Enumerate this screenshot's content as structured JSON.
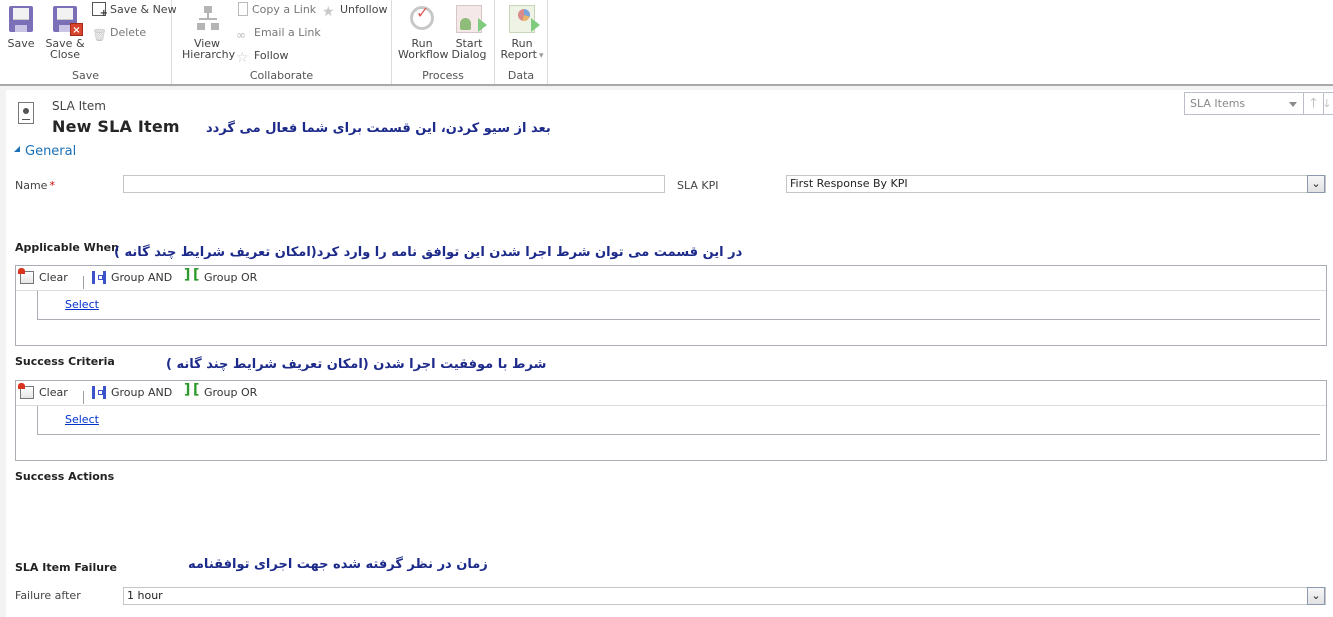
{
  "ribbon": {
    "groups": {
      "save": {
        "label": "Save",
        "save": "Save",
        "save_close_line1": "Save &",
        "save_close_line2": "Close",
        "save_new": "Save & New",
        "delete": "Delete"
      },
      "collaborate": {
        "label": "Collaborate",
        "view_hierarchy_line1": "View",
        "view_hierarchy_line2": "Hierarchy",
        "copy_link": "Copy a Link",
        "email_link": "Email a Link",
        "follow": "Follow",
        "unfollow": "Unfollow"
      },
      "process": {
        "label": "Process",
        "run_workflow_line1": "Run",
        "run_workflow_line2": "Workflow",
        "start_dialog_line1": "Start",
        "start_dialog_line2": "Dialog"
      },
      "data": {
        "label": "Data",
        "run_report_line1": "Run",
        "run_report_line2": "Report",
        "run_report_caret": "▾"
      }
    }
  },
  "header": {
    "entity_type": "SLA Item",
    "title": "New SLA Item",
    "annotation": "بعد از سیو کردن، این قسمت برای شما فعال می گردد",
    "nav": {
      "selected": "SLA Items",
      "up_icon": "🡑",
      "down_icon": "🡓"
    }
  },
  "section": {
    "label": "General"
  },
  "fields": {
    "name": {
      "label": "Name",
      "required_marker": "*",
      "value": ""
    },
    "sla_kpi": {
      "label": "SLA KPI",
      "value": "First Response By KPI"
    },
    "failure_after": {
      "label": "Failure after",
      "value": "1 hour"
    }
  },
  "applicable_when": {
    "label": "Applicable When",
    "annotation": "در این قسمت می توان شرط اجرا شدن این توافق نامه را وارد کرد(امکان تعریف شرایط چند گانه )",
    "toolbar": {
      "clear": "Clear",
      "group_and": "Group AND",
      "group_or": "Group OR"
    },
    "select_link": "Select"
  },
  "success_criteria": {
    "label": "Success Criteria",
    "annotation": "شرط با موفقیت اجرا شدن (امکان تعریف شرایط چند گانه )",
    "toolbar": {
      "clear": "Clear",
      "group_and": "Group AND",
      "group_or": "Group OR"
    },
    "select_link": "Select"
  },
  "success_actions": {
    "label": "Success Actions"
  },
  "sla_item_failure": {
    "label": "SLA Item Failure",
    "annotation": "زمان در نظر گرفته شده جهت اجرای توافقنامه"
  },
  "dropdown_icon": "⌄",
  "colors": {
    "accent": "#1a6fb5",
    "annotation": "#1c2a8a",
    "link": "#0033cc",
    "required": "#cc0000"
  }
}
